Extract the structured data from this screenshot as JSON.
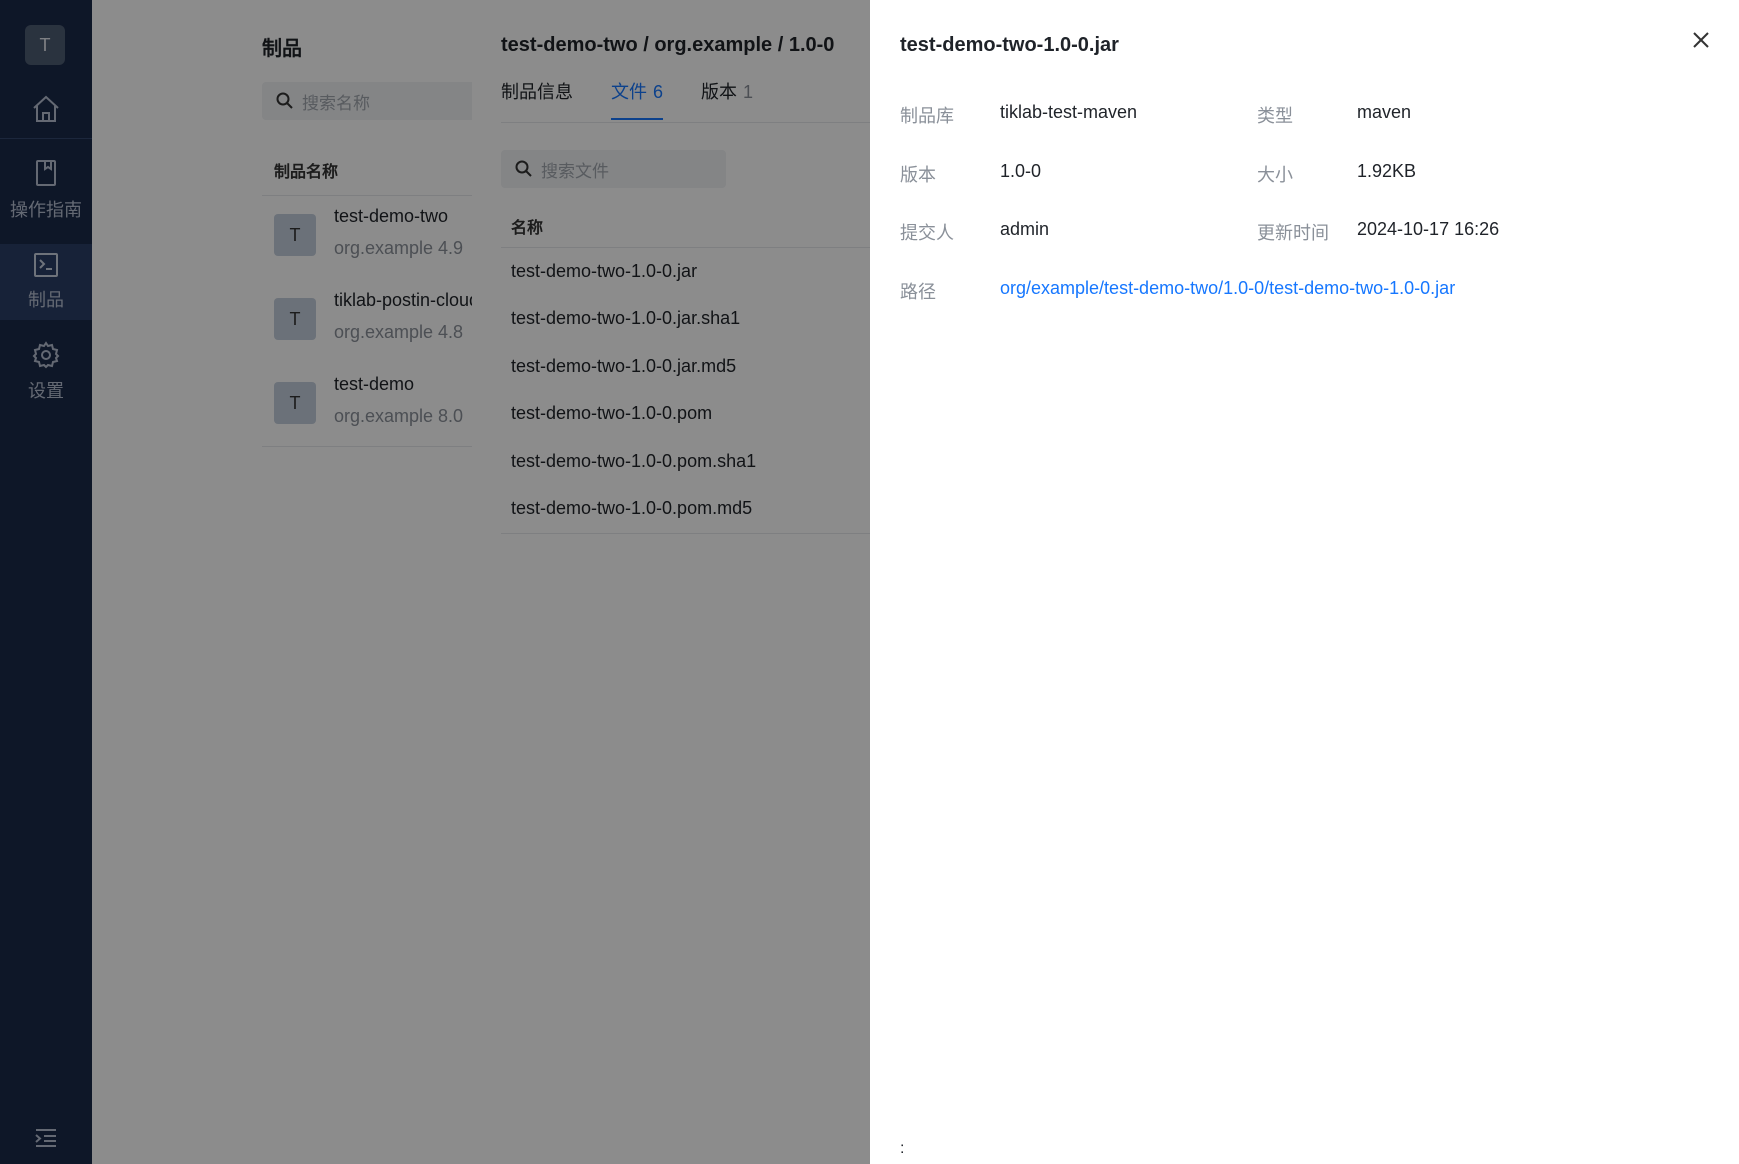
{
  "sidebar": {
    "avatar": "T",
    "items": [
      {
        "label": "",
        "icon": "home-icon"
      },
      {
        "label": "操作指南",
        "icon": "book-icon"
      },
      {
        "label": "制品",
        "icon": "terminal-icon"
      },
      {
        "label": "设置",
        "icon": "gear-icon"
      }
    ]
  },
  "list_page": {
    "title": "制品",
    "search_placeholder": "搜索名称",
    "column_header": "制品名称",
    "rows": [
      {
        "avatar": "T",
        "name": "test-demo-two",
        "group": "org.example",
        "version": "4.9"
      },
      {
        "avatar": "T",
        "name": "tiklab-postin-cloud",
        "group": "org.example",
        "version": "4.8"
      },
      {
        "avatar": "T",
        "name": "test-demo",
        "group": "org.example",
        "version": "8.0"
      }
    ]
  },
  "version_panel": {
    "title": "test-demo-two / org.example / 1.0-0",
    "tabs": [
      {
        "label": "制品信息",
        "count": ""
      },
      {
        "label": "文件",
        "count": "6"
      },
      {
        "label": "版本",
        "count": "1"
      }
    ],
    "search_placeholder": "搜索文件",
    "column_header": "名称",
    "files": [
      "test-demo-two-1.0-0.jar",
      "test-demo-two-1.0-0.jar.sha1",
      "test-demo-two-1.0-0.jar.md5",
      "test-demo-two-1.0-0.pom",
      "test-demo-two-1.0-0.pom.sha1",
      "test-demo-two-1.0-0.pom.md5"
    ]
  },
  "drawer": {
    "title": "test-demo-two-1.0-0.jar",
    "repo_label": "制品库",
    "repo_value": "tiklab-test-maven",
    "type_label": "类型",
    "type_value": "maven",
    "version_label": "版本",
    "version_value": "1.0-0",
    "size_label": "大小",
    "size_value": "1.92KB",
    "submitter_label": "提交人",
    "submitter_value": "admin",
    "updated_label": "更新时间",
    "updated_value": "2024-10-17 16:26",
    "path_label": "路径",
    "path_value": "org/example/test-demo-two/1.0-0/test-demo-two-1.0-0.jar",
    "footer": ":"
  },
  "colors": {
    "sidebar_bg": "#1b2a4a",
    "accent": "#1677ff"
  }
}
